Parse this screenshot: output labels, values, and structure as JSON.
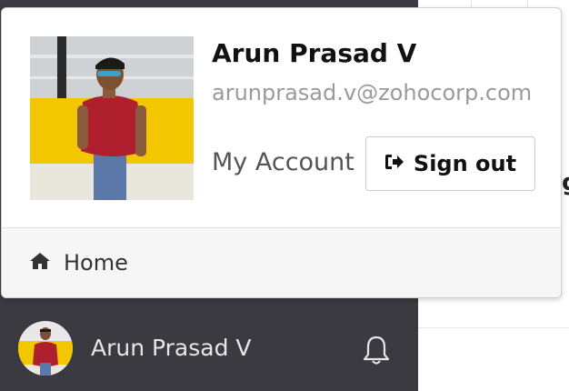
{
  "user": {
    "name": "Arun Prasad V",
    "email": "arunprasad.v@zohocorp.com"
  },
  "popover": {
    "my_account_label": "My Account",
    "signout_label": "Sign out",
    "signout_icon": "sign-out-icon",
    "home_label": "Home",
    "home_icon": "home-icon"
  },
  "bottom_bar": {
    "name": "Arun Prasad V",
    "bell_icon": "bell-icon"
  },
  "colors": {
    "sidebar_bg": "#3a3a40",
    "photo_wall": "#f2c700",
    "shirt": "#b01f2e"
  }
}
